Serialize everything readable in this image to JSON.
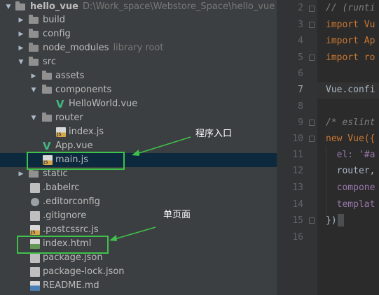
{
  "tree": {
    "rows": [
      {
        "label": "hello_vue",
        "hint": "D:\\Work_space\\Webstore_Space\\hello_vue"
      },
      {
        "label": "build"
      },
      {
        "label": "config"
      },
      {
        "label": "node_modules",
        "hint": "library root"
      },
      {
        "label": "src"
      },
      {
        "label": "assets"
      },
      {
        "label": "components"
      },
      {
        "label": "HelloWorld.vue"
      },
      {
        "label": "router"
      },
      {
        "label": "index.js"
      },
      {
        "label": "App.vue"
      },
      {
        "label": "main.js"
      },
      {
        "label": "static"
      },
      {
        "label": ".babelrc"
      },
      {
        "label": ".editorconfig"
      },
      {
        "label": ".gitignore"
      },
      {
        "label": ".postcssrc.js"
      },
      {
        "label": "index.html"
      },
      {
        "label": "package.json"
      },
      {
        "label": "package-lock.json"
      },
      {
        "label": "README.md"
      }
    ]
  },
  "annotations": {
    "entry": "程序入口",
    "single_page": "单页面"
  },
  "editor": {
    "line_numbers": [
      "2",
      "3",
      "4",
      "5",
      "6",
      "7",
      "8",
      "9",
      "10",
      "11",
      "12",
      "13",
      "14",
      "15",
      "16"
    ],
    "lines": [
      "// (runti",
      "import Vu",
      "import Ap",
      "import ro",
      "",
      "Vue.confi",
      "",
      "/* eslint",
      "new Vue({",
      "  el: '#a",
      "  router,",
      "  compone",
      "  templat",
      "})",
      ""
    ]
  },
  "colors": {
    "accent_box": "#3fc14b",
    "selection": "#0d293e",
    "keyword": "#cc7832"
  }
}
